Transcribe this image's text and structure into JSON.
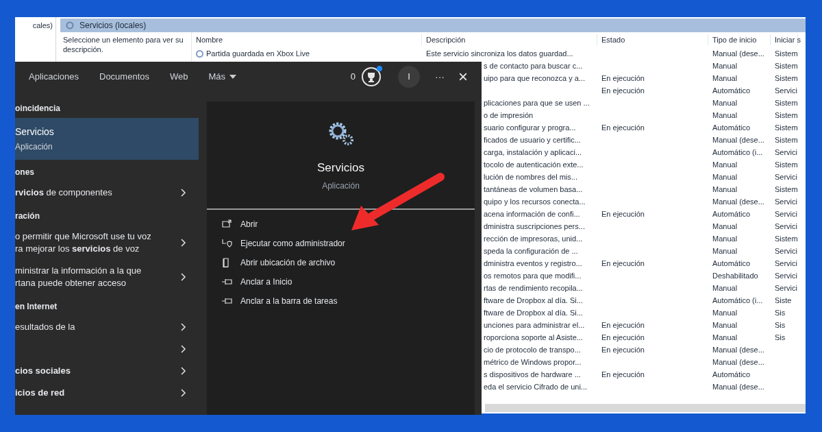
{
  "services_window": {
    "tree_label": "cales)",
    "header": "Servicios (locales)",
    "description_hint": "Seleccione un elemento para ver su descripción.",
    "columns": [
      "Nombre",
      "Descripción",
      "Estado",
      "Tipo de inicio",
      "Iniciar s"
    ],
    "rows": [
      {
        "name": "Partida guardada en Xbox Live",
        "description": "Este servicio sincroniza los datos guardad...",
        "status": "",
        "startup": "Manual (dese...",
        "logon": "Sistem"
      },
      {
        "name": "",
        "description": "s de contacto para buscar c...",
        "status": "",
        "startup": "Manual",
        "logon": "Sistem"
      },
      {
        "name": "",
        "description": "uipo para que reconozca y a...",
        "status": "En ejecución",
        "startup": "Manual",
        "logon": "Sistem"
      },
      {
        "name": "",
        "description": "",
        "status": "En ejecución",
        "startup": "Automático",
        "logon": "Servici"
      },
      {
        "name": "",
        "description": "plicaciones para que se usen ...",
        "status": "",
        "startup": "Manual",
        "logon": "Sistem"
      },
      {
        "name": "",
        "description": "o de impresión",
        "status": "",
        "startup": "Manual",
        "logon": "Sistem"
      },
      {
        "name": "",
        "description": "suario configurar y progra...",
        "status": "En ejecución",
        "startup": "Automático",
        "logon": "Sistem"
      },
      {
        "name": "",
        "description": "ficados de usuario y certific...",
        "status": "",
        "startup": "Manual (dese...",
        "logon": "Sistem"
      },
      {
        "name": "",
        "description": "carga, instalación y aplicaci...",
        "status": "",
        "startup": "Automático (i...",
        "logon": "Servici"
      },
      {
        "name": "",
        "description": "tocolo de autenticación exte...",
        "status": "",
        "startup": "Manual",
        "logon": "Sistem"
      },
      {
        "name": "",
        "description": "lución de nombres del mis...",
        "status": "",
        "startup": "Manual",
        "logon": "Servici"
      },
      {
        "name": "",
        "description": "tantáneas de volumen basa...",
        "status": "",
        "startup": "Manual",
        "logon": "Sistem"
      },
      {
        "name": "",
        "description": "quipo y los recursos conecta...",
        "status": "",
        "startup": "Manual (dese...",
        "logon": "Servici"
      },
      {
        "name": "",
        "description": "acena información de confi...",
        "status": "En ejecución",
        "startup": "Automático",
        "logon": "Servici"
      },
      {
        "name": "",
        "description": "dministra suscripciones pers...",
        "status": "",
        "startup": "Manual",
        "logon": "Servici"
      },
      {
        "name": "",
        "description": "rección de impresoras, unid...",
        "status": "",
        "startup": "Manual",
        "logon": "Sistem"
      },
      {
        "name": "",
        "description": "speda la configuración de ...",
        "status": "",
        "startup": "Manual",
        "logon": "Servici"
      },
      {
        "name": "",
        "description": "dministra eventos y registro...",
        "status": "En ejecución",
        "startup": "Automático",
        "logon": "Servici"
      },
      {
        "name": "",
        "description": "os remotos para que modifi...",
        "status": "",
        "startup": "Deshabilitado",
        "logon": "Servici"
      },
      {
        "name": "",
        "description": "rtas de rendimiento recopila...",
        "status": "",
        "startup": "Manual",
        "logon": "Servici"
      },
      {
        "name": "",
        "description": "ftware de Dropbox al día. Si...",
        "status": "",
        "startup": "Automático (i...",
        "logon": "Siste"
      },
      {
        "name": "",
        "description": "ftware de Dropbox al día. Si...",
        "status": "",
        "startup": "Manual",
        "logon": "Sis"
      },
      {
        "name": "",
        "description": "unciones para administrar el...",
        "status": "En ejecución",
        "startup": "Manual",
        "logon": "Sis"
      },
      {
        "name": "",
        "description": "roporciona soporte al Asiste...",
        "status": "En ejecución",
        "startup": "Manual",
        "logon": "Sis"
      },
      {
        "name": "",
        "description": "cio de protocolo de transpo...",
        "status": "En ejecución",
        "startup": "Manual (dese...",
        "logon": ""
      },
      {
        "name": "",
        "description": "métrico de Windows propor...",
        "status": "",
        "startup": "Manual (dese...",
        "logon": ""
      },
      {
        "name": "",
        "description": "s dispositivos de hardware ...",
        "status": "En ejecución",
        "startup": "Automático",
        "logon": ""
      },
      {
        "name": "",
        "description": "eda el servicio Cifrado de uni...",
        "status": "",
        "startup": "Manual (dese...",
        "logon": ""
      }
    ]
  },
  "search_panel": {
    "tabs": [
      {
        "label": "Aplicaciones",
        "selected": false
      },
      {
        "label": "Documentos",
        "selected": false
      },
      {
        "label": "Web",
        "selected": false
      },
      {
        "label": "Más",
        "selected": false,
        "kind": "dropdown"
      }
    ],
    "points": "0",
    "avatar_letter": "I",
    "more": "···",
    "close": "×",
    "results": [
      {
        "kind": "header",
        "text": "oincidencia"
      },
      {
        "kind": "app",
        "title": "Servicios",
        "subtitle": "Aplicación",
        "selected": true
      },
      {
        "kind": "header",
        "text": "ones"
      },
      {
        "kind": "item",
        "text": "**rvicios** de componentes",
        "selected": false
      },
      {
        "kind": "header",
        "text": "ración"
      },
      {
        "kind": "item",
        "text": "o permitir que Microsoft use tu voz\nra mejorar los **servicios** de voz",
        "selected": false
      },
      {
        "kind": "item",
        "text": "ministrar la información a la que\nrtana puede obtener acceso",
        "selected": false
      },
      {
        "kind": "header",
        "text": "en Internet"
      },
      {
        "kind": "item",
        "text": "esultados de la",
        "selected": false
      },
      {
        "kind": "item",
        "selected": false
      },
      {
        "kind": "item",
        "text": "**cios sociales**",
        "selected": false
      },
      {
        "kind": "item",
        "text": "**icios de red**",
        "selected": false
      }
    ],
    "detail": {
      "title": "Servicios",
      "subtitle": "Aplicación",
      "actions": [
        {
          "kind": "open",
          "label": "Abrir"
        },
        {
          "kind": "admin",
          "label": "Ejecutar como administrador"
        },
        {
          "kind": "location",
          "label": "Abrir ubicación de archivo"
        },
        {
          "kind": "pin",
          "label": "Anclar a Inicio"
        },
        {
          "kind": "pin",
          "label": "Anclar a la barra de tareas"
        }
      ]
    }
  }
}
